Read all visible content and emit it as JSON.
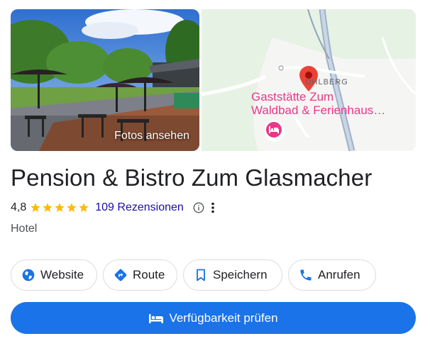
{
  "photo": {
    "label": "Fotos ansehen"
  },
  "map": {
    "place_label": "OHLBERG",
    "poi_name_line1": "Gaststätte Zum",
    "poi_name_line2": "Waldbad & Ferienhaus…",
    "colors": {
      "poi": "#e8388a",
      "pin": "#ea4335",
      "background": "#e8f3e8"
    }
  },
  "business": {
    "name": "Pension & Bistro Zum Glasmacher",
    "rating": "4,8",
    "stars": 5,
    "reviews": "109 Rezensionen",
    "category": "Hotel"
  },
  "actions": [
    {
      "label": "Website",
      "icon": "globe-icon"
    },
    {
      "label": "Route",
      "icon": "directions-icon"
    },
    {
      "label": "Speichern",
      "icon": "bookmark-icon"
    },
    {
      "label": "Anrufen",
      "icon": "phone-icon"
    }
  ],
  "primary_action": {
    "label": "Verfügbarkeit prüfen",
    "icon": "bed-icon"
  },
  "colors": {
    "accent": "#1a73e8",
    "star": "#fbbc04",
    "link": "#1a0dab"
  }
}
